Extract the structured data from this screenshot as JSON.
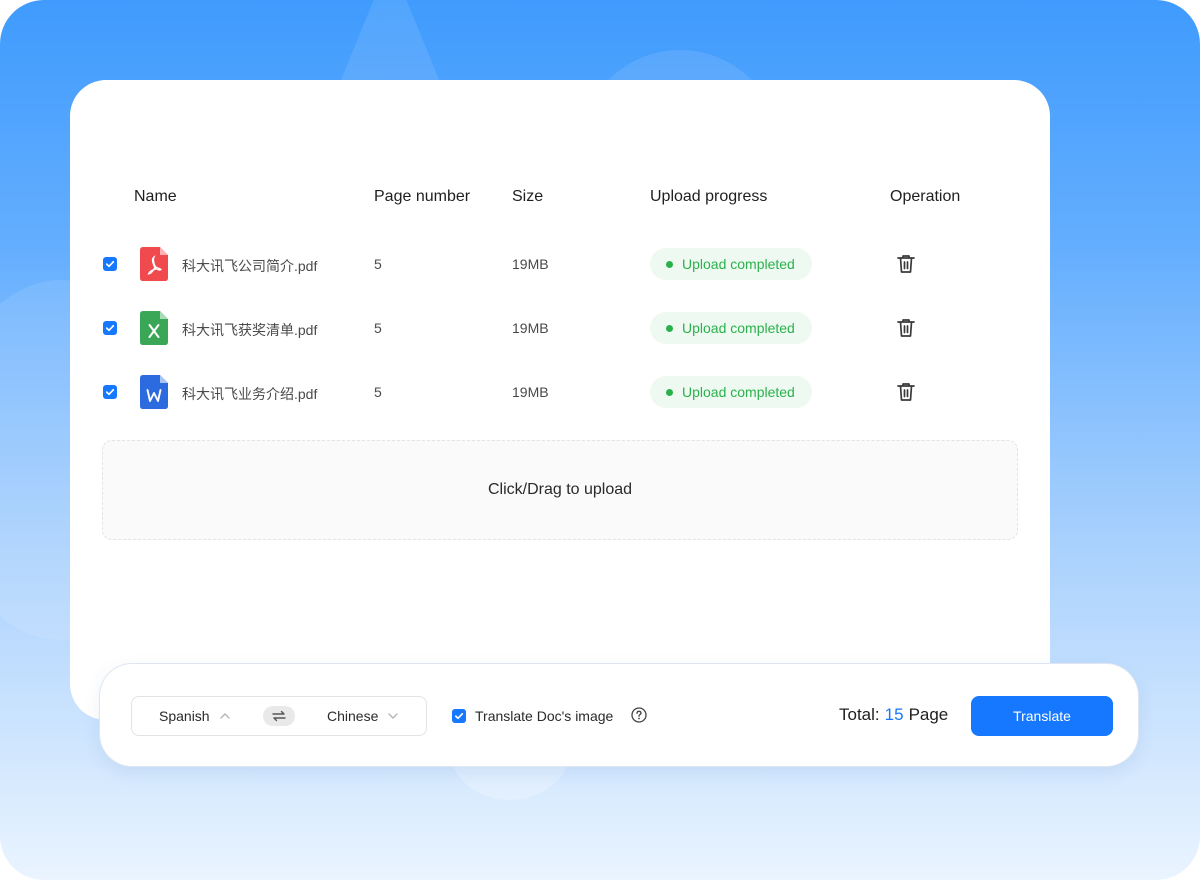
{
  "table": {
    "columns": [
      "Name",
      "Page number",
      "Size",
      "Upload progress",
      "Operation"
    ],
    "rows": [
      {
        "name": "科大讯飞公司简介.pdf",
        "pages": "5",
        "size": "19MB",
        "status": "Upload completed",
        "icon": "pdf-file-icon",
        "checked": true
      },
      {
        "name": "科大讯飞获奖清单.pdf",
        "pages": "5",
        "size": "19MB",
        "status": "Upload completed",
        "icon": "excel-file-icon",
        "checked": true
      },
      {
        "name": "科大讯飞业务介绍.pdf",
        "pages": "5",
        "size": "19MB",
        "status": "Upload completed",
        "icon": "word-file-icon",
        "checked": true
      }
    ]
  },
  "upload": {
    "label": "Click/Drag to upload"
  },
  "bar": {
    "source_lang": "Spanish",
    "target_lang": "Chinese",
    "translate_image_label": "Translate Doc's image",
    "translate_image_checked": true,
    "total_prefix": "Total:",
    "total_pages": "15",
    "total_suffix": "Page",
    "translate_button": "Translate"
  },
  "colors": {
    "accent": "#1677ff",
    "success": "#2bb14c",
    "success_bg": "#eefaf1",
    "pdf": "#f04a4f",
    "excel": "#3aa757",
    "word": "#2c6ae0"
  }
}
